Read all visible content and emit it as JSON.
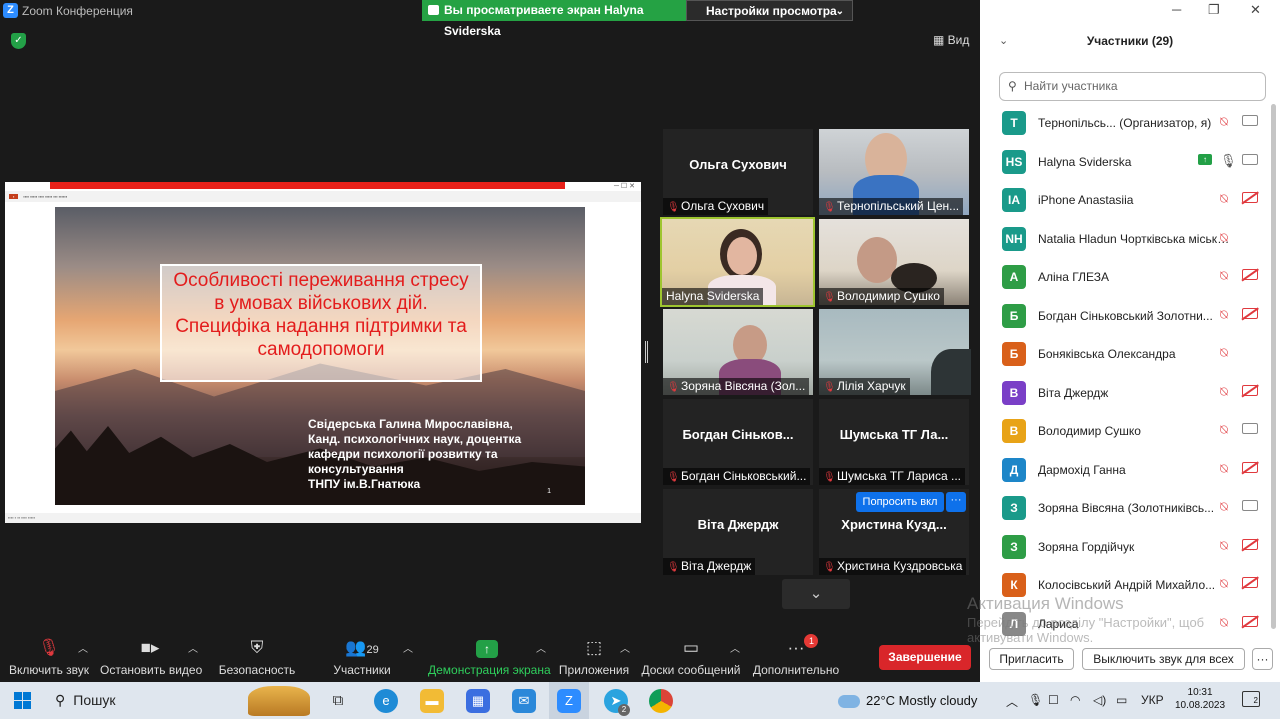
{
  "window": {
    "title": "Zoom Конференция",
    "logo_letter": "Z"
  },
  "share_banner": {
    "text": "Вы просматриваете экран Halyna Sviderska",
    "view_settings": "Настройки просмотра"
  },
  "view_button": "Вид",
  "slide": {
    "title_lines": [
      "Особливості переживання стресу",
      "в умовах військових дій.",
      "Специфіка надання підтримки та",
      "самодопомоги"
    ],
    "author_lines": [
      "Свідерська Галина Мирославівна,",
      "Канд. психологічних наук, доцентка",
      "кафедри психології розвитку та",
      "консультування",
      "ТНПУ ім.В.Гнатюка"
    ],
    "page_number": "1"
  },
  "gallery": [
    {
      "big_name": "Ольга Сухович",
      "label": "Ольга Сухович",
      "video": false
    },
    {
      "big_name": "",
      "label": "Тернопільський Цен...",
      "video": true
    },
    {
      "big_name": "",
      "label": "Halyna Sviderska",
      "video": true,
      "active_speaker": true
    },
    {
      "big_name": "",
      "label": "Володимир Сушко",
      "video": true
    },
    {
      "big_name": "",
      "label": "Зоряна Вівсяна (Зол...",
      "video": true
    },
    {
      "big_name": "",
      "label": "Лілія Харчук",
      "video": true
    },
    {
      "big_name": "Богдан Сіньков...",
      "label": "Богдан Сіньковський...",
      "video": false
    },
    {
      "big_name": "Шумська ТГ Ла...",
      "label": "Шумська ТГ Лариса ...",
      "video": false
    },
    {
      "big_name": "Віта Джердж",
      "label": "Віта Джердж",
      "video": false
    },
    {
      "big_name": "Христина Кузд...",
      "label": "Христина Куздровська",
      "video": false
    }
  ],
  "ask_to_unmute": "Попросить вкл",
  "more_dots": "···",
  "toolbar": {
    "unmute": "Включить звук",
    "stop_video": "Остановить видео",
    "security": "Безопасность",
    "participants": "Участники",
    "participants_count": "29",
    "share_screen": "Демонстрация экрана",
    "apps": "Приложения",
    "whiteboards": "Доски сообщений",
    "more": "Дополнительно",
    "more_badge": "1",
    "end": "Завершение"
  },
  "panel": {
    "header": "Участники (29)",
    "search_placeholder": "Найти участника",
    "participants": [
      {
        "initials": "T",
        "name": "Тернопільсь...  (Организатор, я)",
        "color": "#1a9a8a",
        "mic": "muted",
        "cam": "on"
      },
      {
        "initials": "HS",
        "name": "Halyna Sviderska",
        "color": "#1a9a8a",
        "mic": "on",
        "cam": "on",
        "sharing": true
      },
      {
        "initials": "IA",
        "name": "iPhone Anastasiia",
        "color": "#1a9a8a",
        "mic": "muted",
        "cam": "off"
      },
      {
        "initials": "NH",
        "name": "Natalia Hladun Чортківська міська ...",
        "color": "#1a9a8a",
        "mic": "muted",
        "cam": "none"
      },
      {
        "initials": "А",
        "name": "Аліна ГЛЕЗА",
        "color": "#2e9d46",
        "mic": "muted",
        "cam": "off"
      },
      {
        "initials": "Б",
        "name": "Богдан Сіньковський Золотни...",
        "color": "#2e9d46",
        "mic": "muted",
        "cam": "off"
      },
      {
        "initials": "Б",
        "name": "Боняківська Олександра",
        "color": "#d9601a",
        "mic": "muted",
        "cam": "none"
      },
      {
        "initials": "В",
        "name": "Віта Джердж",
        "color": "#7a3fc7",
        "mic": "muted",
        "cam": "off"
      },
      {
        "initials": "В",
        "name": "Володимир Сушко",
        "color": "#e8a317",
        "mic": "muted",
        "cam": "on"
      },
      {
        "initials": "Д",
        "name": "Дармохід Ганна",
        "color": "#1d86c8",
        "mic": "muted",
        "cam": "off"
      },
      {
        "initials": "З",
        "name": "Зоряна Вівсяна (Золотниківсь...",
        "color": "#1a9a8a",
        "mic": "muted",
        "cam": "on"
      },
      {
        "initials": "З",
        "name": "Зоряна Гордійчук",
        "color": "#2e9d46",
        "mic": "muted",
        "cam": "off"
      },
      {
        "initials": "К",
        "name": "Колосівський Андрій Михайло...",
        "color": "#d9601a",
        "mic": "muted",
        "cam": "off"
      },
      {
        "initials": "Л",
        "name": "Лариса",
        "color": "#888888",
        "mic": "muted",
        "cam": "off"
      }
    ],
    "invite": "Пригласить",
    "mute_all": "Выключить звук для всех",
    "more": "···"
  },
  "watermark": {
    "line1": "Активация Windows",
    "line2": "Перейдіть до розділу \"Настройки\", щоб",
    "line3": "активувати Windows."
  },
  "taskbar": {
    "search": "Пошук",
    "weather": "22°C  Mostly cloudy",
    "lang": "УКР",
    "time": "10:31",
    "date": "10.08.2023",
    "notifications": "2",
    "telegram_badge": "2"
  }
}
